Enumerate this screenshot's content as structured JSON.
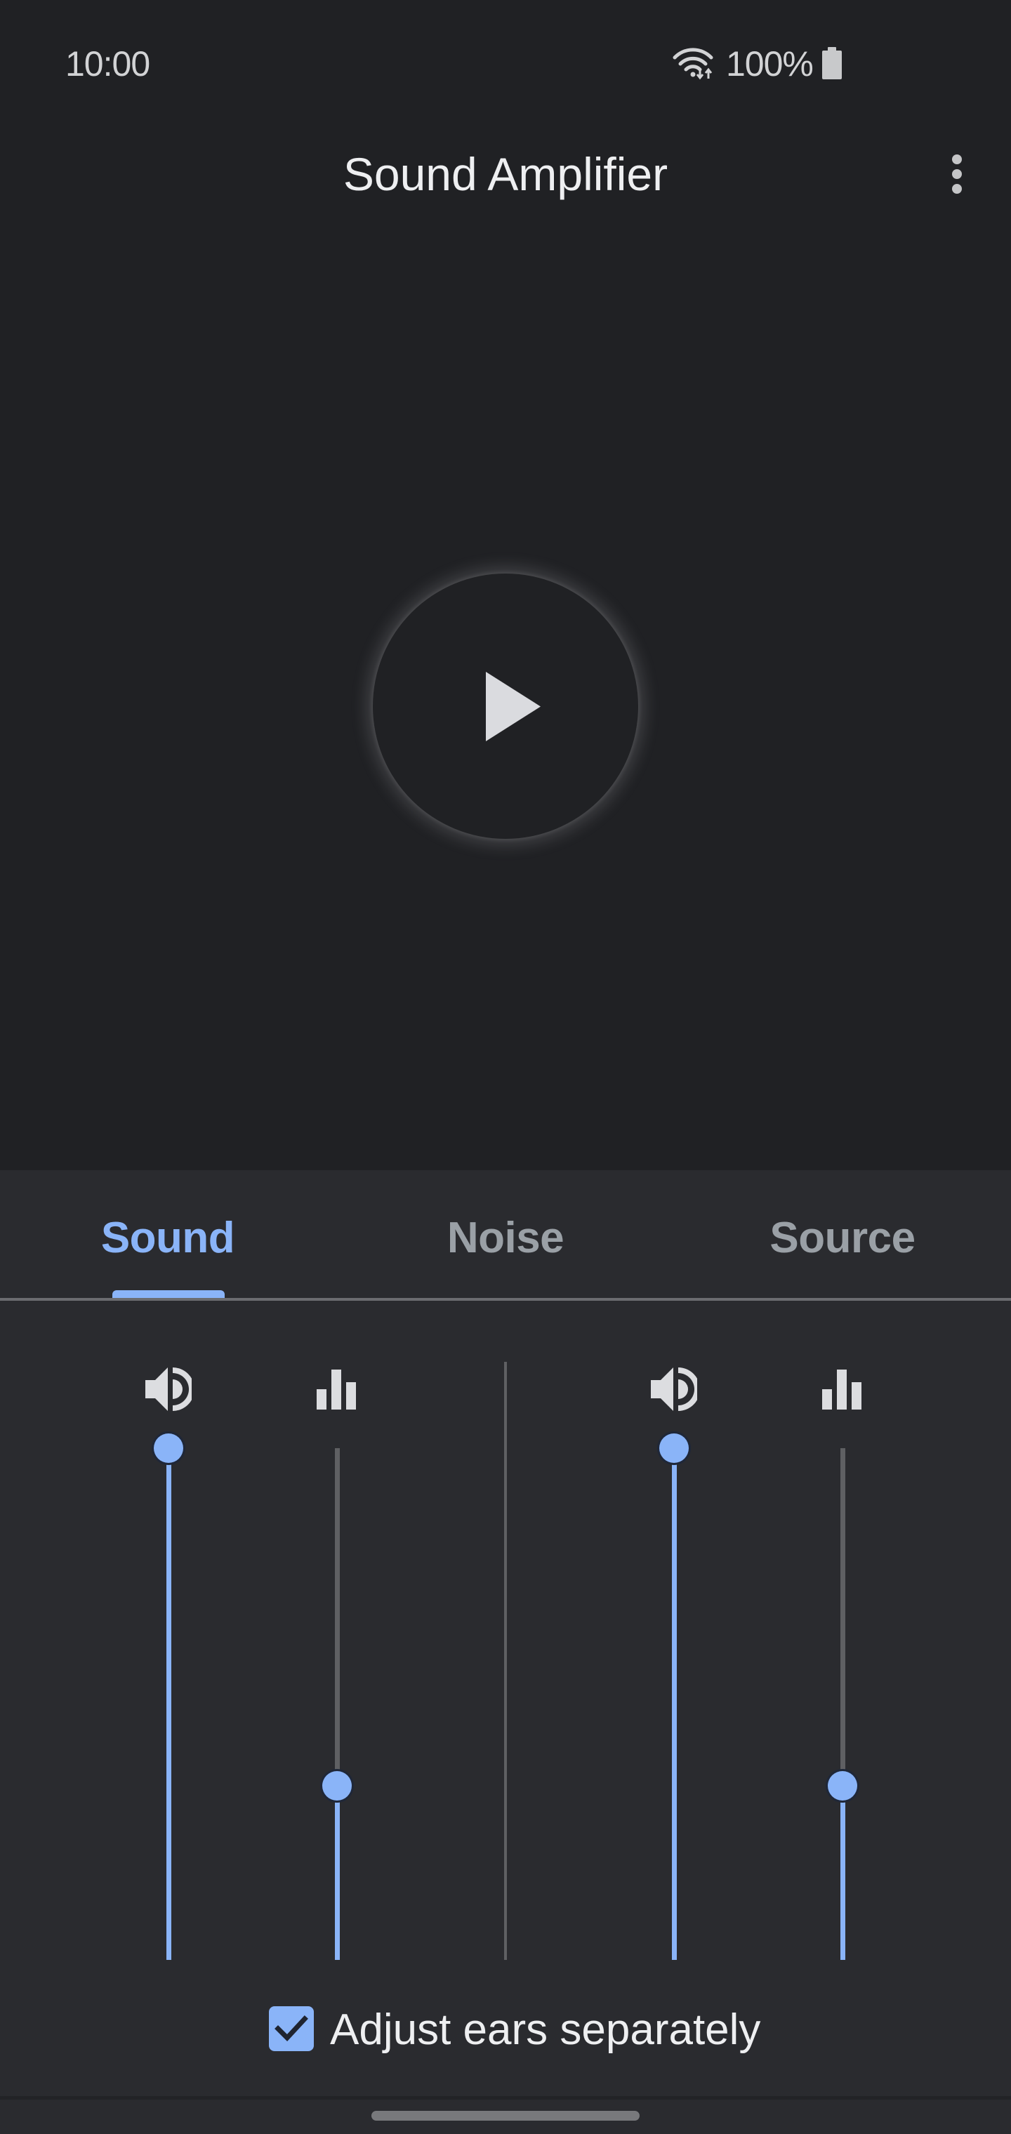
{
  "status_bar": {
    "time": "10:00",
    "battery_percent": "100%",
    "icons": [
      "wifi-icon",
      "battery-icon"
    ]
  },
  "app_bar": {
    "title": "Sound Amplifier",
    "overflow_icon": "more-vert-icon"
  },
  "player": {
    "play_icon": "play-icon",
    "state": "paused"
  },
  "tabs": [
    {
      "label": "Sound",
      "active": true
    },
    {
      "label": "Noise",
      "active": false
    },
    {
      "label": "Source",
      "active": false
    }
  ],
  "sliders": [
    {
      "ear": "left",
      "control": "loudness",
      "icon": "volume-icon",
      "value": 1.0
    },
    {
      "ear": "left",
      "control": "tuning",
      "icon": "equalizer-icon",
      "value": 0.34
    },
    {
      "ear": "right",
      "control": "loudness",
      "icon": "volume-icon",
      "value": 1.0
    },
    {
      "ear": "right",
      "control": "tuning",
      "icon": "equalizer-icon",
      "value": 0.34
    }
  ],
  "adjust_ears": {
    "label": "Adjust ears separately",
    "checked": true
  },
  "colors": {
    "accent": "#8ab4f8",
    "background": "#202124",
    "panel": "#2a2b2f",
    "inactive_tab": "#9aa0a6"
  }
}
